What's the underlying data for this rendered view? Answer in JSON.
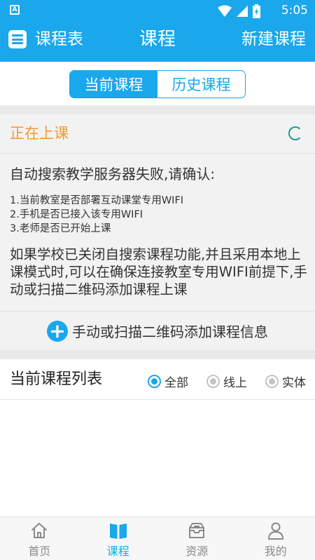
{
  "status_bar": {
    "sim_label": "A",
    "time": "5:05"
  },
  "app_bar": {
    "left_label": "课程表",
    "title": "课程",
    "right_label": "新建课程"
  },
  "segmented": {
    "tabs": [
      "当前课程",
      "历史课程"
    ],
    "active_index": 0
  },
  "live_card": {
    "title": "正在上课",
    "fail_message": "自动搜索教学服务器失败,请确认:",
    "reasons": [
      "1.当前教室是否部署互动课堂专用WIFI",
      "2.手机是否已接入该专用WIFI",
      "3.老师是否已开始上课"
    ],
    "paragraph": "如果学校已关闭自搜索课程功能,并且采用本地上课模式时,可以在确保连接教室专用WIFI前提下,手动或扫描二维码添加课程上课",
    "add_button_label": "手动或扫描二维码添加课程信息"
  },
  "course_list": {
    "title": "当前课程列表",
    "filters": [
      {
        "label": "全部",
        "selected": true
      },
      {
        "label": "线上",
        "selected": false
      },
      {
        "label": "实体",
        "selected": false
      }
    ]
  },
  "tab_bar": {
    "tabs": [
      {
        "label": "首页",
        "icon": "home-icon"
      },
      {
        "label": "课程",
        "icon": "book-icon"
      },
      {
        "label": "资源",
        "icon": "inbox-icon"
      },
      {
        "label": "我的",
        "icon": "person-icon"
      }
    ],
    "active_index": 1
  },
  "colors": {
    "primary": "#1aa7ec",
    "live_title": "#f29b2e",
    "spinner": "#1b9c92",
    "background_gray": "#f2f2f2"
  }
}
